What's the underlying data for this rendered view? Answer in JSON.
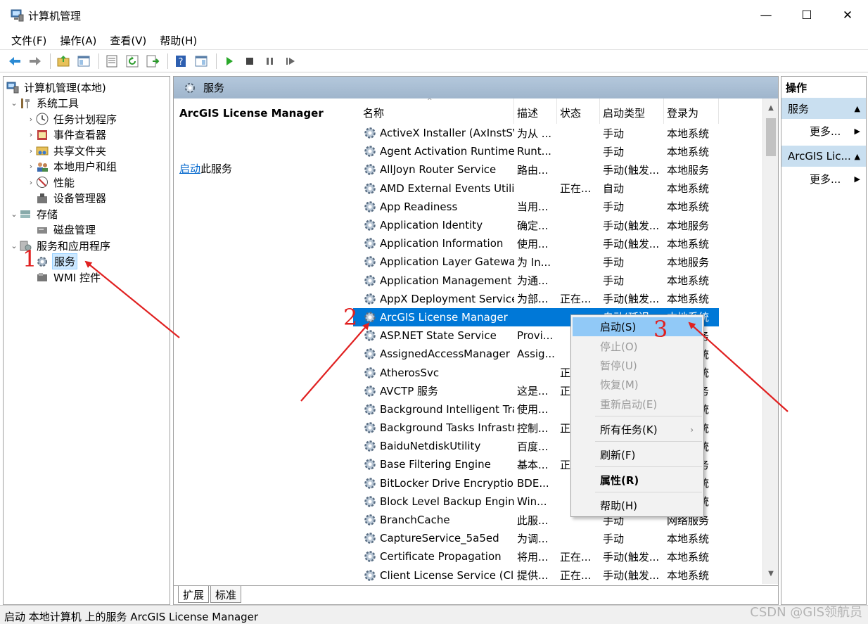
{
  "window": {
    "title": "计算机管理",
    "min": "—",
    "max": "☐",
    "close": "✕"
  },
  "menu": [
    "文件(F)",
    "操作(A)",
    "查看(V)",
    "帮助(H)"
  ],
  "tree": {
    "root": "计算机管理(本地)",
    "system_tools": "系统工具",
    "task_scheduler": "任务计划程序",
    "event_viewer": "事件查看器",
    "shared_folders": "共享文件夹",
    "local_users": "本地用户和组",
    "performance": "性能",
    "device_manager": "设备管理器",
    "storage": "存储",
    "disk_management": "磁盘管理",
    "services_apps": "服务和应用程序",
    "services": "服务",
    "wmi": "WMI 控件"
  },
  "center": {
    "header": "服务",
    "selected_name": "ArcGIS License Manager",
    "start_link": "启动",
    "start_suffix": "此服务"
  },
  "columns": [
    "名称",
    "描述",
    "状态",
    "启动类型",
    "登录为"
  ],
  "services": [
    [
      "ActiveX Installer (AxInstSV)",
      "为从 ...",
      "",
      "手动",
      "本地系统"
    ],
    [
      "Agent Activation Runtime_...",
      "Runt...",
      "",
      "手动",
      "本地系统"
    ],
    [
      "AllJoyn Router Service",
      "路由...",
      "",
      "手动(触发...",
      "本地服务"
    ],
    [
      "AMD External Events Utility",
      "",
      "正在...",
      "自动",
      "本地系统"
    ],
    [
      "App Readiness",
      "当用...",
      "",
      "手动",
      "本地系统"
    ],
    [
      "Application Identity",
      "确定...",
      "",
      "手动(触发...",
      "本地服务"
    ],
    [
      "Application Information",
      "使用...",
      "",
      "手动(触发...",
      "本地系统"
    ],
    [
      "Application Layer Gateway ...",
      "为 In...",
      "",
      "手动",
      "本地服务"
    ],
    [
      "Application Management",
      "为通...",
      "",
      "手动",
      "本地系统"
    ],
    [
      "AppX Deployment Service ...",
      "为部...",
      "正在...",
      "手动(触发...",
      "本地系统"
    ],
    [
      "ArcGIS License Manager",
      "",
      "",
      "自动(延迟...",
      "本地系统"
    ],
    [
      "ASP.NET State Service",
      "Provi...",
      "",
      "手动",
      "网络服务"
    ],
    [
      "AssignedAccessManager ...",
      "Assig...",
      "",
      "手动(触发...",
      "本地系统"
    ],
    [
      "AtherosSvc",
      "",
      "正在...",
      "自动",
      "本地系统"
    ],
    [
      "AVCTP 服务",
      "这是...",
      "正在...",
      "手动(触发...",
      "本地服务"
    ],
    [
      "Background Intelligent Tra...",
      "使用...",
      "",
      "手动",
      "本地系统"
    ],
    [
      "Background Tasks Infrastru...",
      "控制...",
      "正在...",
      "自动",
      "本地系统"
    ],
    [
      "BaiduNetdiskUtility",
      "百度...",
      "",
      "手动",
      "本地系统"
    ],
    [
      "Base Filtering Engine",
      "基本...",
      "正在...",
      "自动",
      "本地服务"
    ],
    [
      "BitLocker Drive Encryption ...",
      "BDE...",
      "",
      "手动(触发...",
      "本地系统"
    ],
    [
      "Block Level Backup Engine ...",
      "Win...",
      "",
      "手动",
      "本地系统"
    ],
    [
      "BranchCache",
      "此服...",
      "",
      "手动",
      "网络服务"
    ],
    [
      "CaptureService_5a5ed",
      "为调...",
      "",
      "手动",
      "本地系统"
    ],
    [
      "Certificate Propagation",
      "将用...",
      "正在...",
      "手动(触发...",
      "本地系统"
    ],
    [
      "Client License Service (Clip...",
      "提供...",
      "正在...",
      "手动(触发...",
      "本地系统"
    ]
  ],
  "tabs": [
    "扩展",
    "标准"
  ],
  "actions": {
    "header": "操作",
    "section1": "服务",
    "more1": "更多...",
    "section2": "ArcGIS Lic...",
    "more2": "更多..."
  },
  "context_menu": [
    "启动(S)",
    "停止(O)",
    "暂停(U)",
    "恢复(M)",
    "重新启动(E)",
    "所有任务(K)",
    "刷新(F)",
    "属性(R)",
    "帮助(H)"
  ],
  "status": "启动 本地计算机 上的服务 ArcGIS License Manager",
  "watermark": "CSDN @GIS领航员",
  "annotations": [
    "1",
    "2",
    "3"
  ],
  "colors": {
    "selection": "#0078d7",
    "menu_hover": "#91c9f7",
    "annotation": "#e02020",
    "header": "#b4c8dc"
  }
}
